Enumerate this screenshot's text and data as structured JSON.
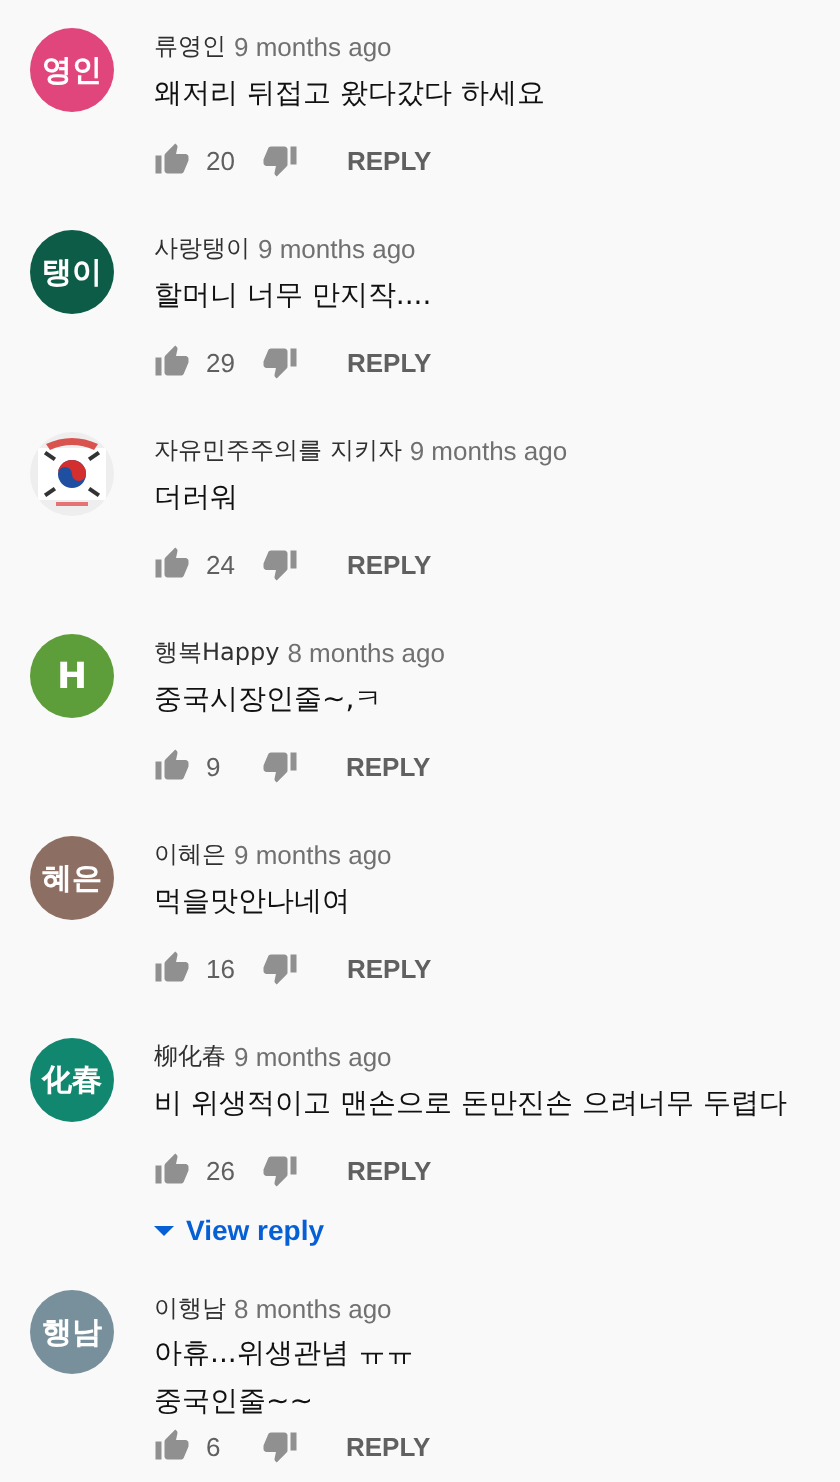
{
  "comments": [
    {
      "avatar": {
        "kind": "initials",
        "text": "영인",
        "color": "#e0457b"
      },
      "author": "류영인",
      "time": "9 months ago",
      "lines": [
        "왜저리 뒤접고 왔다갔다 하세요"
      ],
      "likes": "20",
      "reply": "REPLY"
    },
    {
      "avatar": {
        "kind": "initials",
        "text": "탱이",
        "color": "#0d5c47"
      },
      "author": "사랑탱이",
      "time": "9 months ago",
      "lines": [
        "할머니 너무 만지작...."
      ],
      "likes": "29",
      "reply": "REPLY"
    },
    {
      "avatar": {
        "kind": "picture"
      },
      "author": "자유민주주의를 지키자",
      "time": "9 months ago",
      "lines": [
        "더러워"
      ],
      "likes": "24",
      "reply": "REPLY"
    },
    {
      "avatar": {
        "kind": "initials",
        "text": "H",
        "color": "#5e9e3a"
      },
      "author": "행복Happy",
      "time": "8 months ago",
      "lines": [
        "중국시장인줄~,ㅋ"
      ],
      "likes": "9",
      "reply": "REPLY"
    },
    {
      "avatar": {
        "kind": "initials",
        "text": "혜은",
        "color": "#8d6e63"
      },
      "author": "이혜은",
      "time": "9 months ago",
      "lines": [
        "먹을맛안나네여"
      ],
      "likes": "16",
      "reply": "REPLY"
    },
    {
      "avatar": {
        "kind": "initials",
        "text": "化春",
        "color": "#12876f"
      },
      "author": "柳化春",
      "time": "9 months ago",
      "lines": [
        "비 위생적이고 맨손으로  돈만진손 으려너무 두렵다"
      ],
      "likes": "26",
      "reply": "REPLY",
      "view_reply": "View reply"
    },
    {
      "avatar": {
        "kind": "initials",
        "text": "행남",
        "color": "#78909c"
      },
      "author": "이행남",
      "time": "8 months ago",
      "lines": [
        "아휴...위생관념 ㅠㅠ",
        "중국인줄~~"
      ],
      "likes": "6",
      "reply": "REPLY"
    }
  ]
}
